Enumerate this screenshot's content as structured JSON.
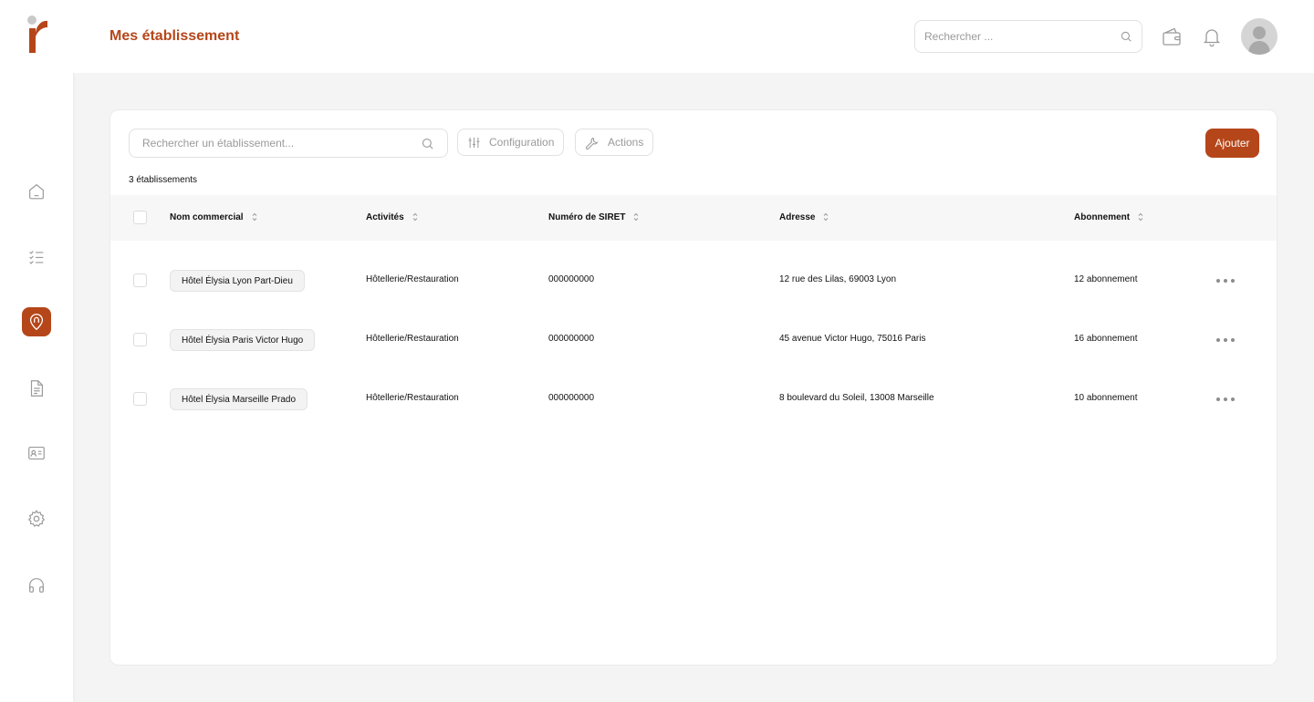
{
  "header": {
    "title": "Mes établissement",
    "search_placeholder": "Rechercher ...",
    "icons": [
      "wallet-icon",
      "bell-icon",
      "user-avatar"
    ]
  },
  "sidebar": {
    "items": [
      {
        "name": "home",
        "icon": "home-icon",
        "active": false
      },
      {
        "name": "tasks",
        "icon": "checklist-icon",
        "active": false
      },
      {
        "name": "establishments",
        "icon": "location-pin-icon",
        "active": true
      },
      {
        "name": "documents",
        "icon": "document-icon",
        "active": false
      },
      {
        "name": "contacts",
        "icon": "id-card-icon",
        "active": false
      },
      {
        "name": "settings",
        "icon": "gear-icon",
        "active": false
      },
      {
        "name": "support",
        "icon": "headphones-icon",
        "active": false
      }
    ]
  },
  "toolbar": {
    "search_placeholder": "Rechercher un établissement...",
    "config_label": "Configuration",
    "actions_label": "Actions",
    "add_label": "Ajouter"
  },
  "list": {
    "count_label": "3 établissements",
    "columns": [
      "Nom commercial",
      "Activités",
      "Numéro de SIRET",
      "Adresse",
      "Abonnement"
    ],
    "rows": [
      {
        "name": "Hôtel Élysia Lyon Part-Dieu",
        "activity": "Hôtellerie/Restauration",
        "siret": "000000000",
        "address": "12 rue des Lilas, 69003 Lyon",
        "subscription": "12 abonnement"
      },
      {
        "name": "Hôtel Élysia Paris Victor Hugo",
        "activity": "Hôtellerie/Restauration",
        "siret": "000000000",
        "address": "45 avenue Victor Hugo, 75016 Paris",
        "subscription": "16 abonnement"
      },
      {
        "name": "Hôtel Élysia Marseille Prado",
        "activity": "Hôtellerie/Restauration",
        "siret": "000000000",
        "address": "8 boulevard du Soleil, 13008 Marseille",
        "subscription": "10 abonnement"
      }
    ]
  },
  "colors": {
    "accent": "#b5461a",
    "background": "#f4f4f4",
    "header_row": "#f7f7f7"
  }
}
